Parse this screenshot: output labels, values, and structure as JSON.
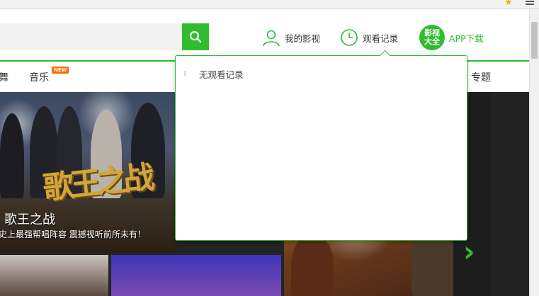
{
  "header": {
    "search": {
      "value": "",
      "placeholder": ""
    },
    "my_video_label": "我的影视",
    "history_label": "观看记录",
    "app_logo_text": [
      "影视",
      "大全"
    ],
    "app_download_label": "APP下载"
  },
  "nav": {
    "items": [
      {
        "label": "舞"
      },
      {
        "label": "音乐",
        "badge": "NEW"
      },
      {
        "label": "专题"
      }
    ]
  },
  "banner": {
    "logo_text": "歌王之战",
    "title": "歌王之战",
    "subtitle": "史上最强帮唱阵容 震撼视听前所未有！"
  },
  "history_dropdown": {
    "empty_text": "无观看记录"
  },
  "icons": [
    "search-icon",
    "user-icon",
    "clock-icon",
    "star-icon",
    "menu-icon",
    "chevron-right-icon"
  ],
  "colors": {
    "accent": "#2fbd2f",
    "badge": "#ff6a00"
  }
}
